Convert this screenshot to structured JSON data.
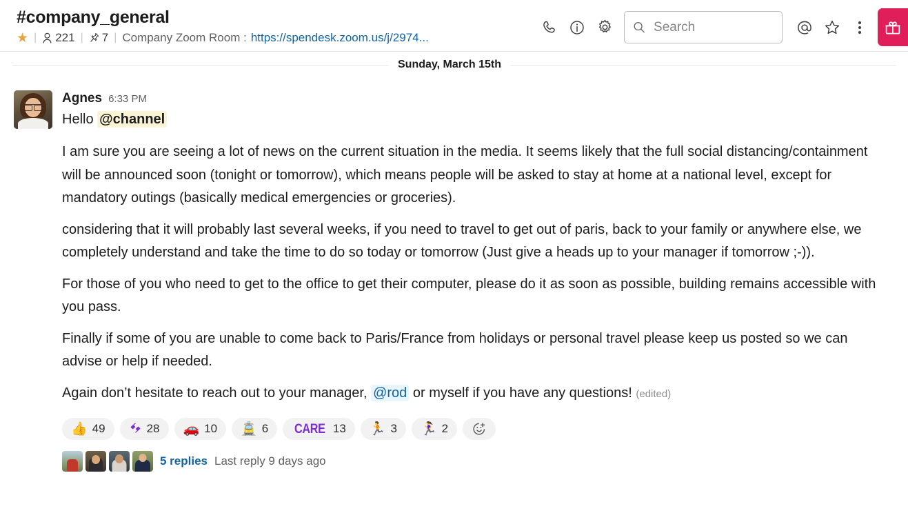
{
  "header": {
    "channel_name": "#company_general",
    "starred": true,
    "star_icon": "star-filled-icon",
    "members_icon": "person-icon",
    "members_count": "221",
    "pins_icon": "pin-icon",
    "pins_count": "7",
    "topic_label": "Company Zoom Room :",
    "topic_link": "https://spendesk.zoom.us/j/2974...",
    "separator": "|",
    "actions": {
      "call_icon": "phone-icon",
      "info_icon": "info-circle-icon",
      "settings_icon": "gear-icon",
      "mentions_icon": "at-mention-icon",
      "star_icon": "star-outline-icon",
      "more_icon": "kebab-menu-icon",
      "gift_icon": "gift-icon"
    },
    "search": {
      "icon": "search-icon",
      "placeholder": "Search",
      "value": ""
    }
  },
  "date_divider": {
    "label": "Sunday, March 15th"
  },
  "message": {
    "author": "Agnes",
    "timestamp": "6:33 PM",
    "avatar_alt": "agnes-avatar",
    "greeting_text": "Hello ",
    "greeting_mention": "@channel",
    "paragraphs": [
      "I am sure you are seeing a lot of news on the current situation in the media. It seems likely that the full social distancing/containment will be announced soon (tonight or tomorrow), which means people will be asked to stay at home at a national level, except for mandatory outings (basically medical emergencies or groceries).",
      "considering that it will probably last several weeks, if you need to travel to get out of paris, back to your family or anywhere else, we completely understand and take the time to do so today or tomorrow  (Just give a heads up to your manager if tomorrow ;-)).",
      "For those of you who need to get to the office to get their computer, please do it as soon as possible, building remains accessible with you pass.",
      "Finally if some of you are unable to come back to Paris/France from holidays or personal travel please keep us posted so we can advise or help if needed."
    ],
    "final_paragraph": {
      "before": "Again don’t hesitate to reach out to your manager, ",
      "mention": "@rod",
      "after": " or myself if you have any questions! ",
      "edited": "(edited)"
    },
    "reactions": [
      {
        "icon": "thumbsup-emoji",
        "glyph": "👍",
        "count": "49"
      },
      {
        "icon": "spendesk-logo-emoji",
        "glyph": "",
        "count": "28"
      },
      {
        "icon": "car-emoji",
        "glyph": "🚗",
        "count": "10"
      },
      {
        "icon": "train-emoji",
        "glyph": "🚊",
        "count": "6"
      },
      {
        "icon": "care-emoji",
        "glyph": "CARE",
        "count": "13"
      },
      {
        "icon": "running-man-emoji",
        "glyph": "🏃",
        "count": "3"
      },
      {
        "icon": "running-woman-emoji",
        "glyph": "🏃‍♀️",
        "count": "2"
      }
    ],
    "add_reaction_icon": "add-reaction-icon",
    "thread": {
      "avatar_count": 4,
      "replies_label": "5 replies",
      "last_reply_label": "Last reply 9 days ago"
    }
  },
  "colors": {
    "accent_blue": "#1264a3",
    "gift_pink": "#e01e5a",
    "mention_channel_bg": "#fbf4d4",
    "mention_user_bg": "#e8f5fa",
    "star_gold": "#e8a33d",
    "care_purple": "#7b2fd4",
    "spendesk_purple": "#7b2fd4"
  }
}
